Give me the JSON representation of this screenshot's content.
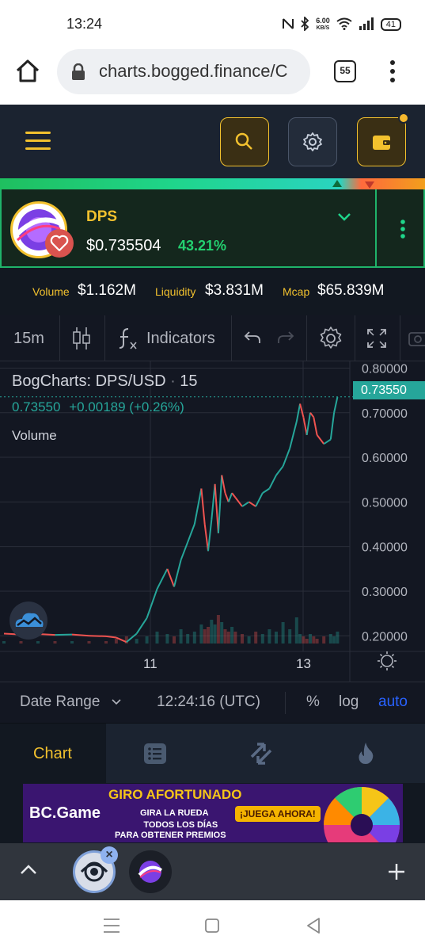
{
  "status_bar": {
    "time": "13:24",
    "net_speed_value": "6.00",
    "net_speed_unit": "KB/S",
    "battery": "41"
  },
  "browser": {
    "url": "charts.bogged.finance/C",
    "tab_count": "55"
  },
  "token": {
    "symbol": "DPS",
    "price": "$0.735504",
    "change_24h": "43.21%"
  },
  "stats": {
    "volume_label": "Volume",
    "volume_value": "$1.162M",
    "liquidity_label": "Liquidity",
    "liquidity_value": "$3.831M",
    "mcap_label": "Mcap",
    "mcap_value": "$65.839M"
  },
  "chart_toolbar": {
    "interval": "15m",
    "indicators_label": "Indicators"
  },
  "chart": {
    "legend_title": "BogCharts: DPS/USD",
    "legend_interval": "15",
    "legend_last": "0.73550",
    "legend_change": "+0.00189 (+0.26%)",
    "volume_label": "Volume",
    "current_price_tag": "0.73550"
  },
  "chart_data": {
    "type": "line",
    "title": "BogCharts: DPS/USD",
    "y_ticks": [
      "0.80000",
      "0.70000",
      "0.60000",
      "0.50000",
      "0.40000",
      "0.30000",
      "0.20000"
    ],
    "x_ticks": [
      "11",
      "13"
    ],
    "ylim": [
      0.165,
      0.815
    ],
    "grid": true,
    "series": [
      {
        "x": [
          0,
          5,
          10,
          15,
          20,
          25,
          30,
          33,
          36,
          39,
          42,
          45,
          48,
          50,
          52,
          54,
          56,
          58,
          59,
          60,
          61,
          62,
          63,
          64,
          65,
          66,
          67,
          68,
          70,
          72,
          74,
          76,
          78,
          80,
          82,
          84,
          86,
          87,
          88,
          89,
          90,
          91,
          92,
          94,
          96,
          97,
          98
        ],
        "values": [
          0.205,
          0.203,
          0.204,
          0.202,
          0.203,
          0.2,
          0.199,
          0.196,
          0.186,
          0.205,
          0.24,
          0.305,
          0.35,
          0.31,
          0.37,
          0.41,
          0.45,
          0.53,
          0.45,
          0.39,
          0.46,
          0.54,
          0.43,
          0.56,
          0.52,
          0.5,
          0.52,
          0.51,
          0.49,
          0.5,
          0.49,
          0.52,
          0.53,
          0.56,
          0.58,
          0.62,
          0.68,
          0.72,
          0.69,
          0.65,
          0.7,
          0.69,
          0.65,
          0.63,
          0.64,
          0.7,
          0.735
        ]
      }
    ],
    "volume": [
      1,
      1,
      1,
      1,
      1,
      1,
      1,
      2,
      3,
      2,
      3,
      5,
      4,
      3,
      6,
      4,
      5,
      8,
      6,
      7,
      10,
      8,
      12,
      9,
      6,
      5,
      7,
      5,
      4,
      3,
      5,
      4,
      6,
      5,
      9,
      6,
      11,
      4,
      3,
      2,
      4,
      3,
      2,
      3,
      4,
      3,
      5
    ],
    "current_price": 0.7355,
    "colors": {
      "up": "#26a69a",
      "down": "#ef5350",
      "grid": "#2a2e39"
    }
  },
  "range_bar": {
    "date_range": "Date Range",
    "time": "12:24:16 (UTC)",
    "percent": "%",
    "log": "log",
    "auto": "auto"
  },
  "bottom_tabs": {
    "chart_label": "Chart"
  },
  "ad": {
    "brand": "BC.Game",
    "headline": "GIRO AFORTUNADO",
    "line1": "GIRA LA RUEDA",
    "line2": "TODOS LOS DÍAS",
    "line3": "PARA OBTENER PREMIOS",
    "cta": "¡JUEGA AHORA!"
  },
  "colors": {
    "accent": "#f2c12e",
    "positive": "#23d170",
    "negative": "#ef5350",
    "chart_teal": "#26a69a"
  }
}
